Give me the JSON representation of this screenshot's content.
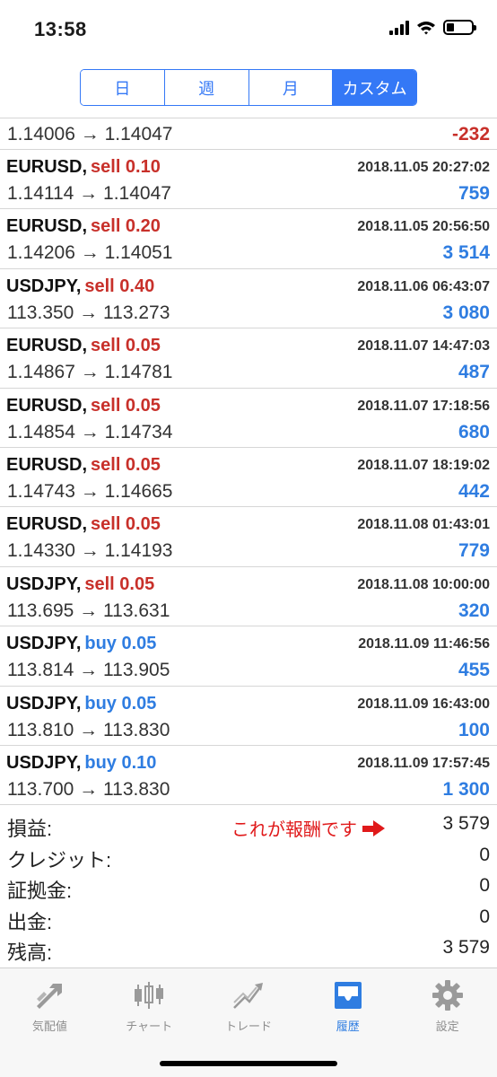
{
  "status_bar": {
    "time": "13:58"
  },
  "period_tabs": [
    {
      "label": "日",
      "active": false
    },
    {
      "label": "週",
      "active": false
    },
    {
      "label": "月",
      "active": false
    },
    {
      "label": "カスタム",
      "active": true
    }
  ],
  "partial_row": {
    "prices": "1.14006 → 1.14047",
    "profit": "-232"
  },
  "trades": [
    {
      "symbol": "EURUSD,",
      "side": "sell 0.10",
      "time": "2018.11.05 20:27:02",
      "prices": "1.14114 → 1.14047",
      "profit": "759"
    },
    {
      "symbol": "EURUSD,",
      "side": "sell 0.20",
      "time": "2018.11.05 20:56:50",
      "prices": "1.14206 → 1.14051",
      "profit": "3 514"
    },
    {
      "symbol": "USDJPY,",
      "side": "sell 0.40",
      "time": "2018.11.06 06:43:07",
      "prices": "113.350 → 113.273",
      "profit": "3 080"
    },
    {
      "symbol": "EURUSD,",
      "side": "sell 0.05",
      "time": "2018.11.07 14:47:03",
      "prices": "1.14867 → 1.14781",
      "profit": "487"
    },
    {
      "symbol": "EURUSD,",
      "side": "sell 0.05",
      "time": "2018.11.07 17:18:56",
      "prices": "1.14854 → 1.14734",
      "profit": "680"
    },
    {
      "symbol": "EURUSD,",
      "side": "sell 0.05",
      "time": "2018.11.07 18:19:02",
      "prices": "1.14743 → 1.14665",
      "profit": "442"
    },
    {
      "symbol": "EURUSD,",
      "side": "sell 0.05",
      "time": "2018.11.08 01:43:01",
      "prices": "1.14330 → 1.14193",
      "profit": "779"
    },
    {
      "symbol": "USDJPY,",
      "side": "sell 0.05",
      "time": "2018.11.08 10:00:00",
      "prices": "113.695 → 113.631",
      "profit": "320"
    },
    {
      "symbol": "USDJPY,",
      "side": "buy 0.05",
      "time": "2018.11.09 11:46:56",
      "prices": "113.814 → 113.905",
      "profit": "455"
    },
    {
      "symbol": "USDJPY,",
      "side": "buy 0.05",
      "time": "2018.11.09 16:43:00",
      "prices": "113.810 → 113.830",
      "profit": "100"
    },
    {
      "symbol": "USDJPY,",
      "side": "buy 0.10",
      "time": "2018.11.09 17:57:45",
      "prices": "113.700 → 113.830",
      "profit": "1 300"
    }
  ],
  "summary": {
    "profit_label": "損益:",
    "profit_value": "3 579",
    "annotation": "これが報酬です",
    "credit_label": "クレジット:",
    "credit_value": "0",
    "deposit_label": "証拠金:",
    "deposit_value": "0",
    "withdrawal_label": "出金:",
    "withdrawal_value": "0",
    "balance_label": "残高:",
    "balance_value": "3 579"
  },
  "tabbar": [
    {
      "label": "気配値",
      "icon": "quotes-arrow-icon"
    },
    {
      "label": "チャート",
      "icon": "candlestick-chart-icon"
    },
    {
      "label": "トレード",
      "icon": "trade-trend-icon"
    },
    {
      "label": "履歴",
      "icon": "history-inbox-icon",
      "active": true
    },
    {
      "label": "設定",
      "icon": "settings-gear-icon"
    }
  ],
  "colors": {
    "accent": "#3478f6",
    "sell": "#c8302a",
    "buy": "#2f7de1",
    "annotation": "#e0191a"
  }
}
